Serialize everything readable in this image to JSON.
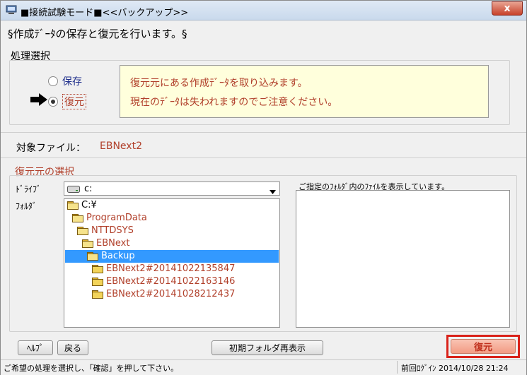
{
  "window": {
    "title": "■接続試験モード■<<バックアップ>>",
    "close_label": "x"
  },
  "heading": "§作成ﾃﾞｰﾀの保存と復元を行います。§",
  "process": {
    "label": "処理選択",
    "options": [
      {
        "label": "保存",
        "selected": false
      },
      {
        "label": "復元",
        "selected": true
      }
    ],
    "arrow_icon": "arrow-right-icon",
    "info_lines": [
      "復元元にある作成ﾃﾞｰﾀを取り込みます。",
      "現在のﾃﾞｰﾀは失われますのでご注意ください。"
    ]
  },
  "target": {
    "label": "対象ファイル：",
    "value": "EBNext2"
  },
  "restore_source": {
    "label": "復元元の選択",
    "drive_label": "ﾄﾞﾗｲﾌﾞ",
    "drive_value": "c:",
    "folder_label": "ﾌｫﾙﾀﾞ",
    "tree": [
      {
        "label": "C:¥",
        "selected": false,
        "red": false
      },
      {
        "label": "ProgramData",
        "selected": false,
        "red": true
      },
      {
        "label": "NTTDSYS",
        "selected": false,
        "red": true
      },
      {
        "label": "EBNext",
        "selected": false,
        "red": true
      },
      {
        "label": "Backup",
        "selected": true,
        "red": false
      },
      {
        "label": "EBNext2#20141022135847",
        "selected": false,
        "red": true
      },
      {
        "label": "EBNext2#20141022163146",
        "selected": false,
        "red": true
      },
      {
        "label": "EBNext2#20141028212437",
        "selected": false,
        "red": true
      }
    ],
    "file_panel_label": "ご指定のﾌｫﾙﾀﾞ内のﾌｧｲﾙを表示しています。"
  },
  "buttons": {
    "help": "ﾍﾙﾌﾟ",
    "back": "戻る",
    "reset_folder": "初期フォルダ再表示",
    "restore": "復元"
  },
  "status": {
    "message": "ご希望の処理を選択し、「確認」を押して下さい。",
    "last_login": "前回ﾛｸﾞｲﾝ 2014/10/28 21:24"
  },
  "colors": {
    "accent_red": "#b1402b",
    "highlight_blue": "#3399ff",
    "restore_button": "#f4a38e"
  }
}
